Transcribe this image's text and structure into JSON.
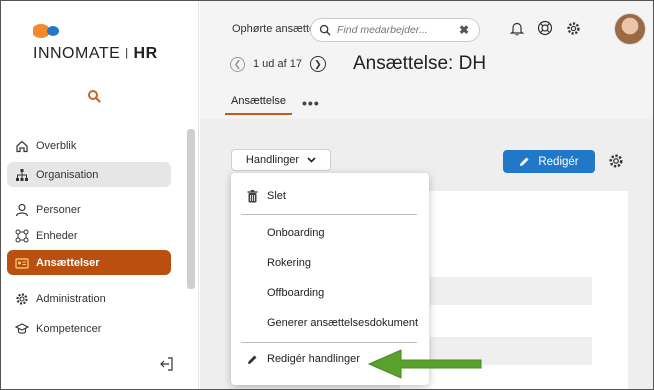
{
  "brand": {
    "name_light": "INNOMATE",
    "sep": "|",
    "name_bold": "HR",
    "colors": {
      "orange": "#f08a2c",
      "blue": "#2178c8"
    }
  },
  "sidebar": {
    "items": [
      {
        "label": "Overblik",
        "icon": "home-icon"
      },
      {
        "label": "Organisation",
        "icon": "org-chart-icon"
      },
      {
        "label": "Personer",
        "icon": "person-icon"
      },
      {
        "label": "Enheder",
        "icon": "units-icon"
      },
      {
        "label": "Ansættelser",
        "icon": "id-card-icon"
      },
      {
        "label": "Administration",
        "icon": "gear-icon"
      },
      {
        "label": "Kompetencer",
        "icon": "graduation-cap-icon"
      }
    ],
    "active_color": "#b9500f"
  },
  "header": {
    "breadcrumb": "Ophørte ansætte",
    "search_placeholder": "Find medarbejder...",
    "search_value": "",
    "clear_symbol": "✖",
    "pager": {
      "text": "1 ud af 17"
    },
    "title": "Ansættelse: DH",
    "tabs": [
      {
        "label": "Ansættelse"
      }
    ],
    "more_symbol": "•••"
  },
  "toolbar": {
    "actions_label": "Handlinger",
    "edit_label": "Redigér"
  },
  "dropdown": {
    "delete_label": "Slet",
    "items": [
      {
        "label": "Onboarding"
      },
      {
        "label": "Rokering"
      },
      {
        "label": "Offboarding"
      },
      {
        "label": "Generer ansættelsesdokument"
      }
    ],
    "edit_actions_label": "Redigér handlinger"
  },
  "annotation": {
    "arrow_color": "#5aa02c"
  }
}
